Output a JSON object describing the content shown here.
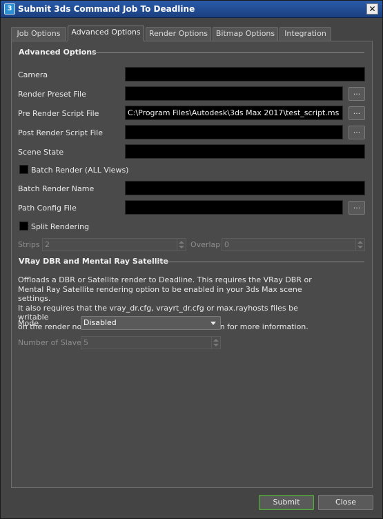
{
  "window": {
    "title": "Submit 3ds Command Job To Deadline",
    "icon_glyph": "3",
    "close_glyph": "✕"
  },
  "tabs": [
    {
      "label": "Job Options"
    },
    {
      "label": "Advanced Options",
      "active": true
    },
    {
      "label": "Render Options"
    },
    {
      "label": "Bitmap Options"
    },
    {
      "label": "Integration"
    }
  ],
  "advanced": {
    "group_title": "Advanced Options",
    "camera": {
      "label": "Camera",
      "value": ""
    },
    "render_preset": {
      "label": "Render Preset File",
      "value": "",
      "browse": "..."
    },
    "pre_render_script": {
      "label": "Pre Render Script File",
      "value": "C:\\Program Files\\Autodesk\\3ds Max 2017\\test_script.ms",
      "browse": "..."
    },
    "post_render_script": {
      "label": "Post Render Script File",
      "value": "",
      "browse": "..."
    },
    "scene_state": {
      "label": "Scene State",
      "value": ""
    },
    "batch_render": {
      "label": "Batch Render (ALL Views)",
      "checked": false
    },
    "batch_render_name": {
      "label": "Batch Render Name",
      "value": ""
    },
    "path_config": {
      "label": "Path Config File",
      "value": "",
      "browse": "..."
    },
    "split_rendering": {
      "label": "Split Rendering",
      "checked": false
    },
    "strips": {
      "label": "Strips",
      "value": "2",
      "enabled": false
    },
    "overlap": {
      "label": "Overlap",
      "value": "0",
      "enabled": false
    }
  },
  "vray": {
    "group_title": "VRay DBR and Mental Ray Satellite",
    "description_lines": [
      "Offloads a DBR or Satellite render to Deadline. This requires the VRay DBR or",
      "Mental Ray Satellite rendering option to be enabled in your 3ds Max scene settings.",
      "It also requires that the vray_dr.cfg, vrayrt_dr.cfg or max.rayhosts files be writable",
      "on the render nodes. See the 3ds Cmd documentation for more information."
    ],
    "mode": {
      "label": "Mode",
      "value": "Disabled"
    },
    "num_slaves": {
      "label": "Number of Slaves",
      "value": "5",
      "enabled": false
    }
  },
  "footer": {
    "submit_label": "Submit",
    "close_label": "Close"
  },
  "colors": {
    "accent_submit_border": "#5ea84a",
    "titlebar": "#2a5ba8",
    "field_bg": "#000000",
    "panel_bg": "#4a4a4a"
  }
}
